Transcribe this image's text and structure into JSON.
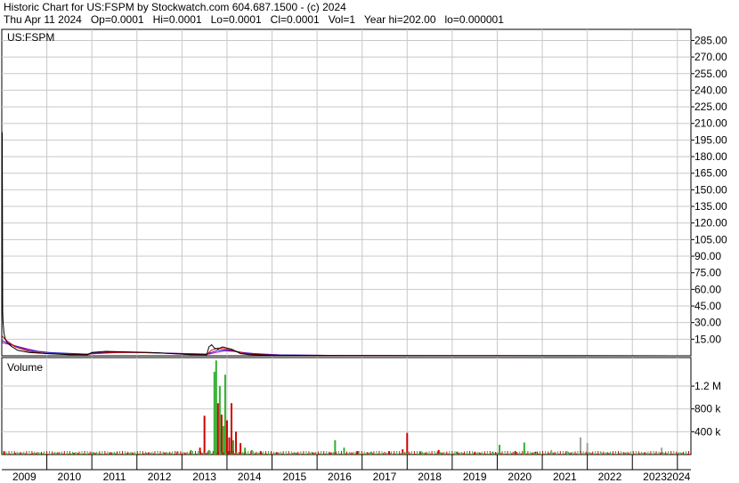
{
  "header": {
    "title": "Historic Chart for US:FSPM by Stockwatch.com 604.687.1500 - (c) 2024",
    "quote_line": "Thu Apr 11 2024   Op=0.0001   Hi=0.0001   Lo=0.0001   Cl=0.0001   Vol=1   Year hi=202.00   lo=0.000001"
  },
  "colors": {
    "grid": "#c8c8c8",
    "price_line": "#000000",
    "ma_red": "#d00000",
    "ma_blue": "#2020c0",
    "ma_magenta": "#c000c0",
    "volume_up": "#30b030",
    "volume_down": "#d00000",
    "volume_neutral": "#a0a0a0"
  },
  "chart_data": [
    {
      "type": "line",
      "panel": "price",
      "legend": "US:FSPM",
      "x_ticks": [
        "2009",
        "2010",
        "2011",
        "2012",
        "2013",
        "2014",
        "2015",
        "2016",
        "2017",
        "2018",
        "2019",
        "2020",
        "2021",
        "2022",
        "2023",
        "2024"
      ],
      "y_ticks": [
        "285.00",
        "270.00",
        "255.00",
        "240.00",
        "225.00",
        "210.00",
        "195.00",
        "180.00",
        "165.00",
        "150.00",
        "135.00",
        "120.00",
        "105.00",
        "90.00",
        "75.00",
        "60.00",
        "45.00",
        "30.00",
        "15.00"
      ],
      "ylim": [
        0,
        295
      ],
      "grid": true,
      "series": [
        {
          "color": "price_line",
          "x": [
            2009.0,
            2009.01,
            2009.02,
            2009.03,
            2009.05,
            2009.08,
            2009.12,
            2009.2,
            2009.35,
            2009.6,
            2010.0,
            2010.5,
            2010.9,
            2011.0,
            2011.3,
            2011.8,
            2012.3,
            2012.8,
            2013.2,
            2013.55,
            2013.6,
            2013.66,
            2013.72,
            2013.8,
            2013.9,
            2014.0,
            2014.1,
            2014.2,
            2014.3,
            2014.5,
            2015.0,
            2016.0,
            2017.0,
            2018.0,
            2019.0,
            2020.0,
            2021.0,
            2022.0,
            2023.0,
            2024.0,
            2024.27
          ],
          "y": [
            10,
            202,
            40,
            30,
            20,
            15,
            12,
            9,
            5,
            3,
            2,
            1,
            1,
            3,
            4,
            3.5,
            3,
            2,
            1,
            1,
            8,
            10,
            7,
            6,
            8,
            7,
            6,
            4,
            2,
            1,
            0.5,
            0.3,
            0.2,
            0.1,
            0.1,
            0.05,
            0.02,
            0.01,
            0.005,
            0.001,
            0.0001
          ]
        },
        {
          "color": "ma_red",
          "x": [
            2009.0,
            2009.1,
            2009.3,
            2009.6,
            2010.0,
            2010.9,
            2011.0,
            2011.5,
            2012.0,
            2012.5,
            2013.0,
            2013.55,
            2013.65,
            2013.8,
            2014.0,
            2014.2,
            2014.4,
            2015.0,
            2017.0,
            2020.0,
            2024.27
          ],
          "y": [
            18,
            14,
            8,
            4,
            2,
            1,
            2,
            3,
            3,
            2.5,
            1.5,
            1,
            5,
            7,
            6,
            4,
            2,
            0.5,
            0.2,
            0.05,
            0.0001
          ]
        },
        {
          "color": "ma_blue",
          "x": [
            2009.0,
            2009.1,
            2009.3,
            2009.6,
            2010.0,
            2010.9,
            2011.0,
            2011.5,
            2012.0,
            2012.5,
            2013.0,
            2013.55,
            2013.65,
            2013.8,
            2014.0,
            2014.2,
            2014.4,
            2015.0,
            2017.0,
            2020.0,
            2024.27
          ],
          "y": [
            14,
            12,
            9,
            5,
            3,
            1.5,
            2.5,
            3.5,
            3,
            2.5,
            2,
            1.5,
            3,
            5,
            5,
            4,
            2.5,
            0.8,
            0.2,
            0.05,
            0.0001
          ]
        },
        {
          "color": "ma_magenta",
          "x": [
            2009.0,
            2009.2,
            2009.5,
            2009.8,
            2010.3,
            2010.9,
            2011.1,
            2011.6,
            2012.1,
            2012.6,
            2013.1,
            2013.6,
            2013.75,
            2013.95,
            2014.15,
            2014.35,
            2014.6,
            2015.2,
            2017.0,
            2020.0,
            2024.27
          ],
          "y": [
            12,
            10,
            7,
            4,
            2,
            1.5,
            2,
            3,
            3,
            2.5,
            2,
            1.5,
            3,
            4.5,
            4,
            3,
            2,
            0.8,
            0.2,
            0.05,
            0.0001
          ]
        }
      ]
    },
    {
      "type": "bar",
      "panel": "volume",
      "legend": "Volume",
      "y_ticks": [
        "1.2 M",
        "800 k",
        "400 k"
      ],
      "ylim": [
        0,
        1700000
      ],
      "grid": true,
      "bars": [
        {
          "x": 2009.05,
          "v": 60000,
          "c": "down"
        },
        {
          "x": 2009.3,
          "v": 30000,
          "c": "up"
        },
        {
          "x": 2009.7,
          "v": 25000,
          "c": "down"
        },
        {
          "x": 2010.2,
          "v": 20000,
          "c": "up"
        },
        {
          "x": 2010.6,
          "v": 25000,
          "c": "down"
        },
        {
          "x": 2011.0,
          "v": 40000,
          "c": "up"
        },
        {
          "x": 2011.4,
          "v": 30000,
          "c": "down"
        },
        {
          "x": 2011.8,
          "v": 25000,
          "c": "up"
        },
        {
          "x": 2012.2,
          "v": 30000,
          "c": "down"
        },
        {
          "x": 2012.6,
          "v": 35000,
          "c": "up"
        },
        {
          "x": 2012.9,
          "v": 50000,
          "c": "down"
        },
        {
          "x": 2013.2,
          "v": 80000,
          "c": "up"
        },
        {
          "x": 2013.4,
          "v": 120000,
          "c": "down"
        },
        {
          "x": 2013.5,
          "v": 680000,
          "c": "down"
        },
        {
          "x": 2013.6,
          "v": 80000,
          "c": "up"
        },
        {
          "x": 2013.72,
          "v": 1450000,
          "c": "up"
        },
        {
          "x": 2013.76,
          "v": 1650000,
          "c": "up"
        },
        {
          "x": 2013.8,
          "v": 900000,
          "c": "down"
        },
        {
          "x": 2013.84,
          "v": 1200000,
          "c": "up"
        },
        {
          "x": 2013.88,
          "v": 700000,
          "c": "down"
        },
        {
          "x": 2013.92,
          "v": 500000,
          "c": "up"
        },
        {
          "x": 2013.96,
          "v": 1400000,
          "c": "up"
        },
        {
          "x": 2014.0,
          "v": 600000,
          "c": "down"
        },
        {
          "x": 2014.05,
          "v": 300000,
          "c": "down"
        },
        {
          "x": 2014.1,
          "v": 900000,
          "c": "down"
        },
        {
          "x": 2014.14,
          "v": 250000,
          "c": "up"
        },
        {
          "x": 2014.2,
          "v": 400000,
          "c": "down"
        },
        {
          "x": 2014.3,
          "v": 200000,
          "c": "down"
        },
        {
          "x": 2014.4,
          "v": 120000,
          "c": "up"
        },
        {
          "x": 2014.55,
          "v": 80000,
          "c": "up"
        },
        {
          "x": 2014.75,
          "v": 60000,
          "c": "down"
        },
        {
          "x": 2015.1,
          "v": 40000,
          "c": "up"
        },
        {
          "x": 2015.5,
          "v": 30000,
          "c": "down"
        },
        {
          "x": 2015.9,
          "v": 40000,
          "c": "up"
        },
        {
          "x": 2016.3,
          "v": 35000,
          "c": "down"
        },
        {
          "x": 2016.4,
          "v": 250000,
          "c": "up"
        },
        {
          "x": 2016.6,
          "v": 120000,
          "c": "up"
        },
        {
          "x": 2016.9,
          "v": 60000,
          "c": "down"
        },
        {
          "x": 2017.2,
          "v": 50000,
          "c": "up"
        },
        {
          "x": 2017.6,
          "v": 60000,
          "c": "down"
        },
        {
          "x": 2017.9,
          "v": 90000,
          "c": "down"
        },
        {
          "x": 2018.0,
          "v": 380000,
          "c": "down"
        },
        {
          "x": 2018.3,
          "v": 60000,
          "c": "up"
        },
        {
          "x": 2018.7,
          "v": 80000,
          "c": "down"
        },
        {
          "x": 2019.1,
          "v": 50000,
          "c": "up"
        },
        {
          "x": 2019.5,
          "v": 40000,
          "c": "down"
        },
        {
          "x": 2019.9,
          "v": 50000,
          "c": "up"
        },
        {
          "x": 2020.05,
          "v": 170000,
          "c": "up"
        },
        {
          "x": 2020.4,
          "v": 60000,
          "c": "down"
        },
        {
          "x": 2020.6,
          "v": 210000,
          "c": "up"
        },
        {
          "x": 2020.85,
          "v": 50000,
          "c": "down"
        },
        {
          "x": 2021.2,
          "v": 80000,
          "c": "neutral"
        },
        {
          "x": 2021.55,
          "v": 60000,
          "c": "neutral"
        },
        {
          "x": 2021.85,
          "v": 300000,
          "c": "neutral"
        },
        {
          "x": 2022.0,
          "v": 200000,
          "c": "neutral"
        },
        {
          "x": 2022.3,
          "v": 40000,
          "c": "neutral"
        },
        {
          "x": 2022.7,
          "v": 30000,
          "c": "neutral"
        },
        {
          "x": 2023.1,
          "v": 20000,
          "c": "neutral"
        },
        {
          "x": 2023.5,
          "v": 25000,
          "c": "neutral"
        },
        {
          "x": 2023.65,
          "v": 120000,
          "c": "neutral"
        },
        {
          "x": 2024.1,
          "v": 15000,
          "c": "neutral"
        }
      ]
    }
  ]
}
